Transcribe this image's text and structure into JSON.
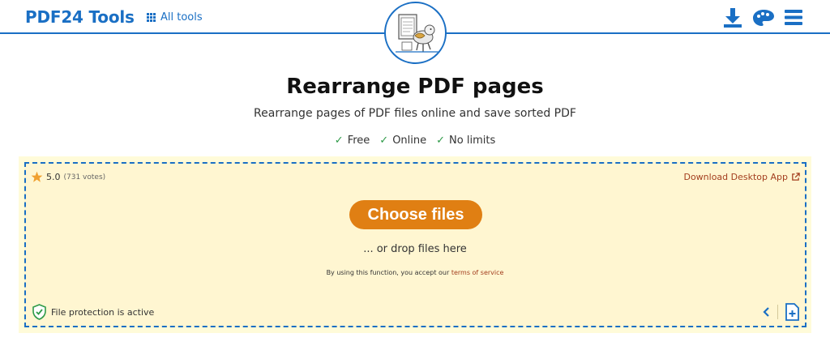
{
  "header": {
    "brand": "PDF24 Tools",
    "all_tools_label": "All tools",
    "icons": [
      "grid-icon",
      "download-icon",
      "palette-icon",
      "menu-icon"
    ]
  },
  "hero": {
    "title": "Rearrange PDF pages",
    "subtitle": "Rearrange pages of PDF files online and save sorted PDF",
    "features": [
      {
        "check": "✓",
        "label": "Free"
      },
      {
        "check": "✓",
        "label": "Online"
      },
      {
        "check": "✓",
        "label": "No limits"
      }
    ]
  },
  "dropzone": {
    "rating_value": "5.0",
    "rating_votes": "(731 votes)",
    "desktop_app_label": "Download Desktop App",
    "choose_files_label": "Choose files",
    "drop_text": "... or drop files here",
    "terms_prefix": "By using this function, you accept our",
    "terms_link": "terms of service",
    "protection_label": "File protection is active"
  },
  "colors": {
    "brand_blue": "#1a6fc4",
    "button_orange": "#e07f13",
    "zone_background": "#fff6d1",
    "link_red": "#a33e1e",
    "check_green": "#2e9a48",
    "star_orange": "#f0a030"
  }
}
